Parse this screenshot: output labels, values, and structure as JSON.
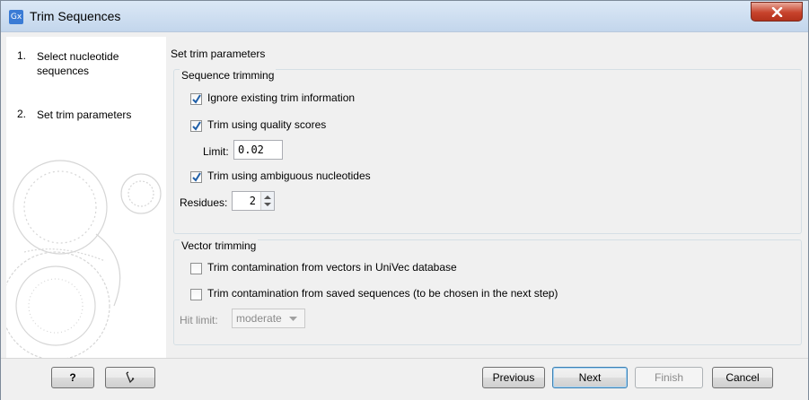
{
  "window": {
    "title": "Trim Sequences",
    "app_icon_text": "Gx"
  },
  "sidebar": {
    "steps": [
      {
        "number": "1.",
        "label": "Select nucleotide sequences"
      },
      {
        "number": "2.",
        "label": "Set trim parameters"
      }
    ]
  },
  "main": {
    "title": "Set trim parameters",
    "sequence_trimming": {
      "title": "Sequence trimming",
      "ignore_existing": {
        "label": "Ignore existing trim information",
        "checked": true
      },
      "quality_scores": {
        "label": "Trim using quality scores",
        "checked": true
      },
      "limit": {
        "label": "Limit:",
        "value": "0.02"
      },
      "ambiguous": {
        "label": "Trim using ambiguous nucleotides",
        "checked": true
      },
      "residues": {
        "label": "Residues:",
        "value": "2"
      }
    },
    "vector_trimming": {
      "title": "Vector trimming",
      "univec": {
        "label": "Trim contamination from vectors in UniVec database",
        "checked": false
      },
      "saved": {
        "label": "Trim contamination from saved sequences (to be chosen in the next step)",
        "checked": false
      },
      "hit_limit": {
        "label": "Hit limit:",
        "value": "moderate"
      }
    }
  },
  "footer": {
    "help_label": "?",
    "previous_label": "Previous",
    "next_label": "Next",
    "finish_label": "Finish",
    "cancel_label": "Cancel"
  },
  "colors": {
    "accent": "#3c7fb1",
    "close_button": "#c7432c",
    "check": "#1f5fa8"
  },
  "icons": {
    "close": "close-icon",
    "reset": "reset-icon"
  }
}
